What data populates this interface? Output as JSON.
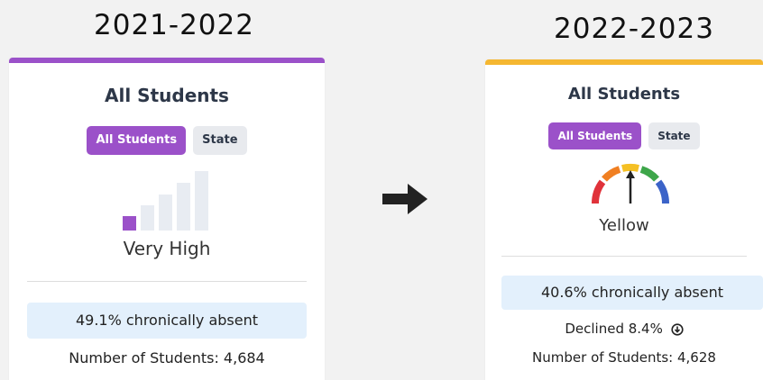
{
  "years": {
    "left": "2021-2022",
    "right": "2022-2023"
  },
  "colors": {
    "left_accent": "#9b51c9",
    "right_accent": "#f5b731",
    "button_active": "#9b51c9",
    "button_inactive": "#e8eaee",
    "absent_box": "#e3f0fc"
  },
  "left_card": {
    "title": "All Students",
    "toggle": {
      "all_students": "All Students",
      "state": "State"
    },
    "indicator_icon": "bars-level-icon",
    "status": "Very High",
    "absent_text": "49.1% chronically absent",
    "students_text": "Number of Students: 4,684"
  },
  "right_card": {
    "title": "All Students",
    "toggle": {
      "all_students": "All Students",
      "state": "State"
    },
    "indicator_icon": "gauge-icon",
    "status": "Yellow",
    "absent_text": "40.6% chronically absent",
    "declined_text": "Declined 8.4%",
    "declined_icon": "down-circle-icon",
    "students_text": "Number of Students: 4,628"
  },
  "transition_icon": "right-arrow-icon"
}
